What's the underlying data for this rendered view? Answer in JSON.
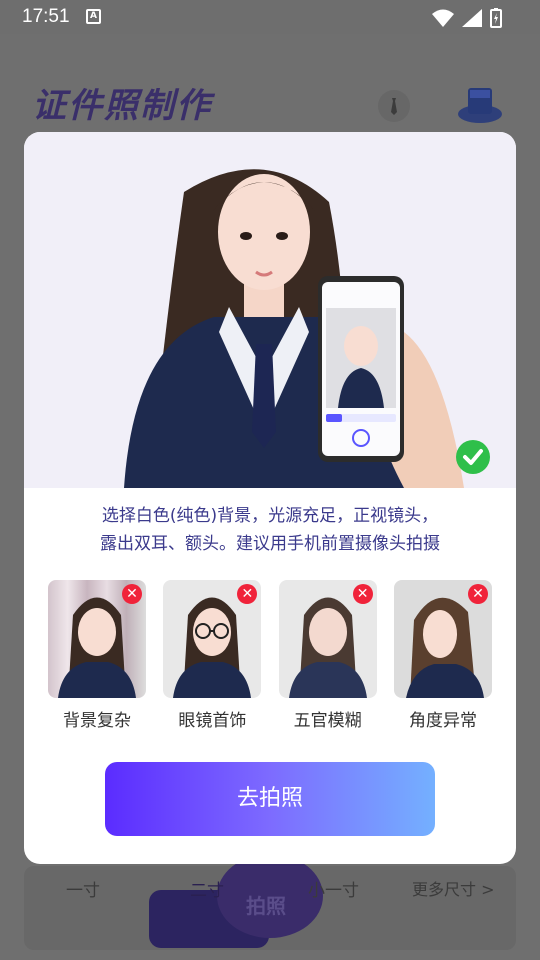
{
  "status_bar": {
    "time": "17:51",
    "notification_badge": "A",
    "icons": [
      "wifi-icon",
      "signal-icon",
      "battery-charging-icon"
    ]
  },
  "background_app": {
    "title": "证件照制作",
    "tabs": [
      "一寸",
      "二寸",
      "小一寸",
      "更多尺寸 >"
    ],
    "shoot_label": "拍照"
  },
  "modal": {
    "instructions_line1": "选择白色(纯色)背景，光源充足，正视镜头，",
    "instructions_line2": "露出双耳、额头。建议用手机前置摄像头拍摄",
    "samples": [
      {
        "label": "背景复杂",
        "status": "invalid"
      },
      {
        "label": "眼镜首饰",
        "status": "invalid"
      },
      {
        "label": "五官模糊",
        "status": "invalid"
      },
      {
        "label": "角度异常",
        "status": "invalid"
      }
    ],
    "cta_label": "去拍照"
  },
  "colors": {
    "accent_start": "#5b2cff",
    "accent_end": "#74b0ff",
    "success": "#2fbf4a",
    "error": "#f0233a",
    "text_blue": "#3b3a8c"
  }
}
